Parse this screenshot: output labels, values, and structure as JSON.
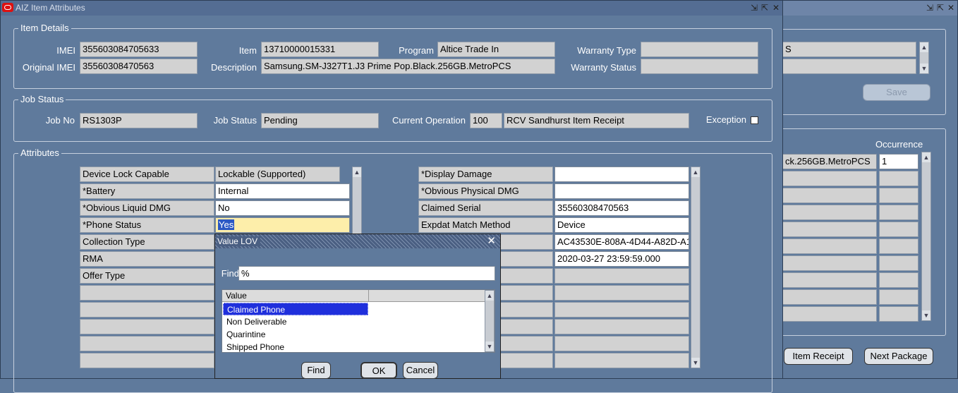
{
  "main_window": {
    "title": "AIZ Item Attributes",
    "item_details": {
      "legend": "Item Details",
      "imei_label": "IMEI",
      "imei": "355603084705633",
      "original_imei_label": "Original IMEI",
      "original_imei": "35560308470563",
      "item_label": "Item",
      "item": "13710000015331",
      "description_label": "Description",
      "description": "Samsung.SM-J327T1.J3 Prime Pop.Black.256GB.MetroPCS",
      "program_label": "Program",
      "program": "Altice Trade In",
      "warranty_type_label": "Warranty Type",
      "warranty_type": "",
      "warranty_status_label": "Warranty Status",
      "warranty_status": ""
    },
    "job_status": {
      "legend": "Job Status",
      "job_no_label": "Job No",
      "job_no": "RS1303P",
      "job_status_label": "Job Status",
      "job_status": "Pending",
      "current_operation_label": "Current Operation",
      "operation_code": "100",
      "operation_name": "RCV Sandhurst Item Receipt",
      "exception_label": "Exception"
    },
    "attributes": {
      "legend": "Attributes",
      "left": [
        {
          "name": "Device Lock Capable",
          "value": "Lockable (Supported)"
        },
        {
          "name": "*Battery",
          "value": "Internal"
        },
        {
          "name": "*Obvious Liquid DMG",
          "value": "No"
        },
        {
          "name": "*Phone Status",
          "value": "Yes"
        },
        {
          "name": "Collection Type",
          "value": ""
        },
        {
          "name": "RMA",
          "value": ""
        },
        {
          "name": "Offer Type",
          "value": ""
        }
      ],
      "right": [
        {
          "name": "*Display Damage",
          "value": ""
        },
        {
          "name": "*Obvious Physical DMG",
          "value": ""
        },
        {
          "name": "Claimed Serial",
          "value": "35560308470563"
        },
        {
          "name": "Expdat Match Method",
          "value": "Device"
        },
        {
          "name": "",
          "value": "AC43530E-808A-4D44-A82D-A1"
        },
        {
          "name": "",
          "value": "2020-03-27 23:59:59.000"
        }
      ]
    }
  },
  "back_window": {
    "field1": "S",
    "save_label": "Save",
    "occurrence_label": "Occurrence",
    "row1_desc": "ck.256GB.MetroPCS",
    "row1_occurrence": "1",
    "item_receipt_label": "Item Receipt",
    "next_package_label": "Next Package"
  },
  "lov_dialog": {
    "title": "Value LOV",
    "find_label": "Find",
    "find_value": "%",
    "column_header": "Value",
    "options": [
      "Claimed Phone",
      "Non Deliverable",
      "Quarintine",
      "Shipped Phone"
    ],
    "selected_option": "Claimed Phone",
    "find_button": "Find",
    "ok_button": "OK",
    "cancel_button": "Cancel"
  },
  "colors": {
    "background": "#5f7a9c",
    "selection": "#1f2fdc",
    "current_field": "#fdeeaa"
  }
}
